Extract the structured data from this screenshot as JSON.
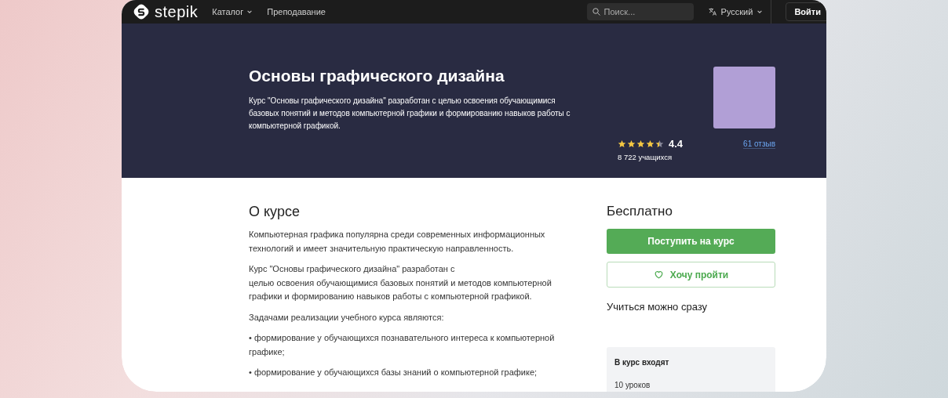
{
  "navbar": {
    "logo": "stepik",
    "links": [
      {
        "label": "Каталог",
        "dropdown": true
      },
      {
        "label": "Преподавание",
        "dropdown": false
      }
    ],
    "search": {
      "placeholder": "Поиск..."
    },
    "language": "Русский",
    "login": "Войти"
  },
  "hero": {
    "title": "Основы графического дизайна",
    "description": "Курс \"Основы графического дизайна\" разработан с целью освоения обучающимися базовых понятий и методов компьютерной графики и формированию навыков работы с компьютерной графикой.",
    "stars": 4.4,
    "rating": "4.4",
    "learners": "8 722 учащихся",
    "reviews": "61 отзыв"
  },
  "about": {
    "heading": "О курсе",
    "paragraphs": [
      "Компьютерная графика популярна среди современных информационных технологий и имеет значительную практическую направленность.",
      "Курс \"Основы графического дизайна\" разработан с\nцелью освоения обучающимися базовых понятий и методов компьютерной графики и формированию навыков работы с компьютерной графикой.",
      "Задачами реализации учебного курса являются:",
      "• формирование у обучающихся познавательного интереса к компьютерной графике;",
      "• формирование у обучающихся базы знаний о компьютерной графике;"
    ]
  },
  "sidebar": {
    "price": "Бесплатно",
    "enroll_button": "Поступить на курс",
    "wishlist_button": "Хочу пройти",
    "note": "Учиться можно сразу",
    "includes": {
      "title": "В курс входят",
      "items": [
        "10 уроков"
      ]
    }
  }
}
